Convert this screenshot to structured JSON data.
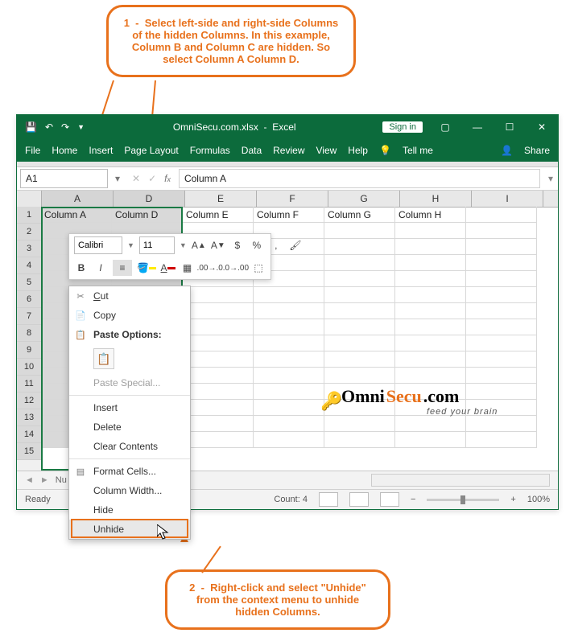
{
  "callouts": {
    "c1": "1  -  Select left-side and right-side Columns of the hidden Columns. In this example, Column B and Column C are hidden. So select Column A Column D.",
    "c2": "2  -  Right-click and select \"Unhide\" from the context menu to unhide hidden Columns."
  },
  "titlebar": {
    "filename": "OmniSecu.com.xlsx",
    "app": "Excel",
    "signin": "Sign in"
  },
  "ribbon": {
    "file": "File",
    "home": "Home",
    "insert": "Insert",
    "pagelayout": "Page Layout",
    "formulas": "Formulas",
    "data": "Data",
    "review": "Review",
    "view": "View",
    "help": "Help",
    "tellme": "Tell me",
    "share": "Share"
  },
  "namebox": "A1",
  "formula": "Column A",
  "columns": [
    "A",
    "D",
    "E",
    "F",
    "G",
    "H",
    "I"
  ],
  "row1": [
    "Column A",
    "Column D",
    "Column E",
    "Column F",
    "Column G",
    "Column H",
    ""
  ],
  "minitb": {
    "font": "Calibri",
    "size": "11"
  },
  "ctx": {
    "cut": "Cut",
    "copy": "Copy",
    "pasteopt": "Paste Options:",
    "pastespecial": "Paste Special...",
    "insert": "Insert",
    "delete": "Delete",
    "clear": "Clear Contents",
    "format": "Format Cells...",
    "colwidth": "Column Width...",
    "hide": "Hide",
    "unhide": "Unhide"
  },
  "status": {
    "ready": "Ready",
    "count_label": "Count:",
    "count": "4",
    "zoom": "100%"
  },
  "sheet": {
    "num": "Nu"
  },
  "watermark": {
    "omni": "Omni",
    "secu": "Secu",
    "dotcom": ".com",
    "feed": "feed your brain"
  }
}
